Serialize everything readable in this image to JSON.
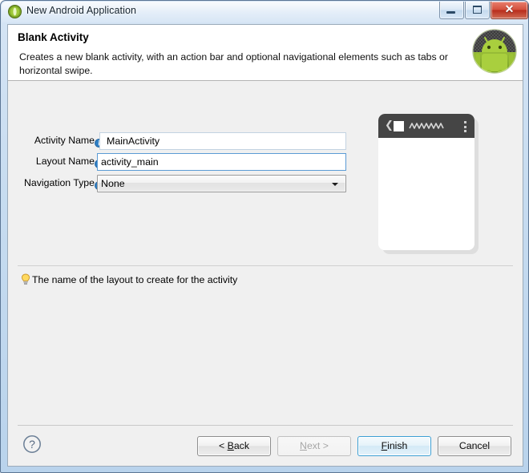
{
  "window": {
    "title": "New Android Application",
    "icon": "android-app-icon",
    "controls": {
      "minimize": "minimize-button",
      "restore": "restore-button",
      "close_glyph": "✕"
    }
  },
  "header": {
    "title": "Blank Activity",
    "description": "Creates a new blank activity, with an action bar and optional navigational elements such as tabs or horizontal swipe.",
    "logo": "android-robot-logo"
  },
  "form": {
    "fields": [
      {
        "label": "Activity Name",
        "info_icon": "info-icon",
        "value": "MainActivity",
        "type": "text",
        "focused": false
      },
      {
        "label": "Layout Name",
        "info_icon": "info-icon",
        "value": "activity_main",
        "type": "text",
        "focused": true
      },
      {
        "label": "Navigation Type",
        "info_icon": "info-icon",
        "value": "None",
        "type": "combo",
        "focused": false
      }
    ]
  },
  "preview": {
    "name": "blank-activity-preview",
    "action_bar": {
      "back_glyph": "❮",
      "app_icon": "app-icon",
      "title_placeholder": "zigzag-title-placeholder",
      "overflow": "overflow-menu-icon"
    }
  },
  "hint": {
    "icon": "lightbulb-icon",
    "text": "The name of the layout to create for the activity"
  },
  "footer": {
    "help_icon": "help-icon",
    "buttons": [
      {
        "name": "back-button",
        "pre": "< ",
        "mnemonic": "B",
        "post": "ack",
        "enabled": true,
        "default": false
      },
      {
        "name": "next-button",
        "pre": "",
        "mnemonic": "N",
        "post": "ext >",
        "enabled": false,
        "default": false
      },
      {
        "name": "finish-button",
        "pre": "",
        "mnemonic": "F",
        "post": "inish",
        "enabled": true,
        "default": true
      },
      {
        "name": "cancel-button",
        "pre": "",
        "mnemonic": "",
        "post": "Cancel",
        "enabled": true,
        "default": false
      }
    ]
  },
  "colors": {
    "accent_blue": "#3c9fd4",
    "android_green": "#a4c639",
    "action_bar": "#454545",
    "dialog_bg": "#f0f0f0",
    "close_red": "#b82d1c"
  }
}
